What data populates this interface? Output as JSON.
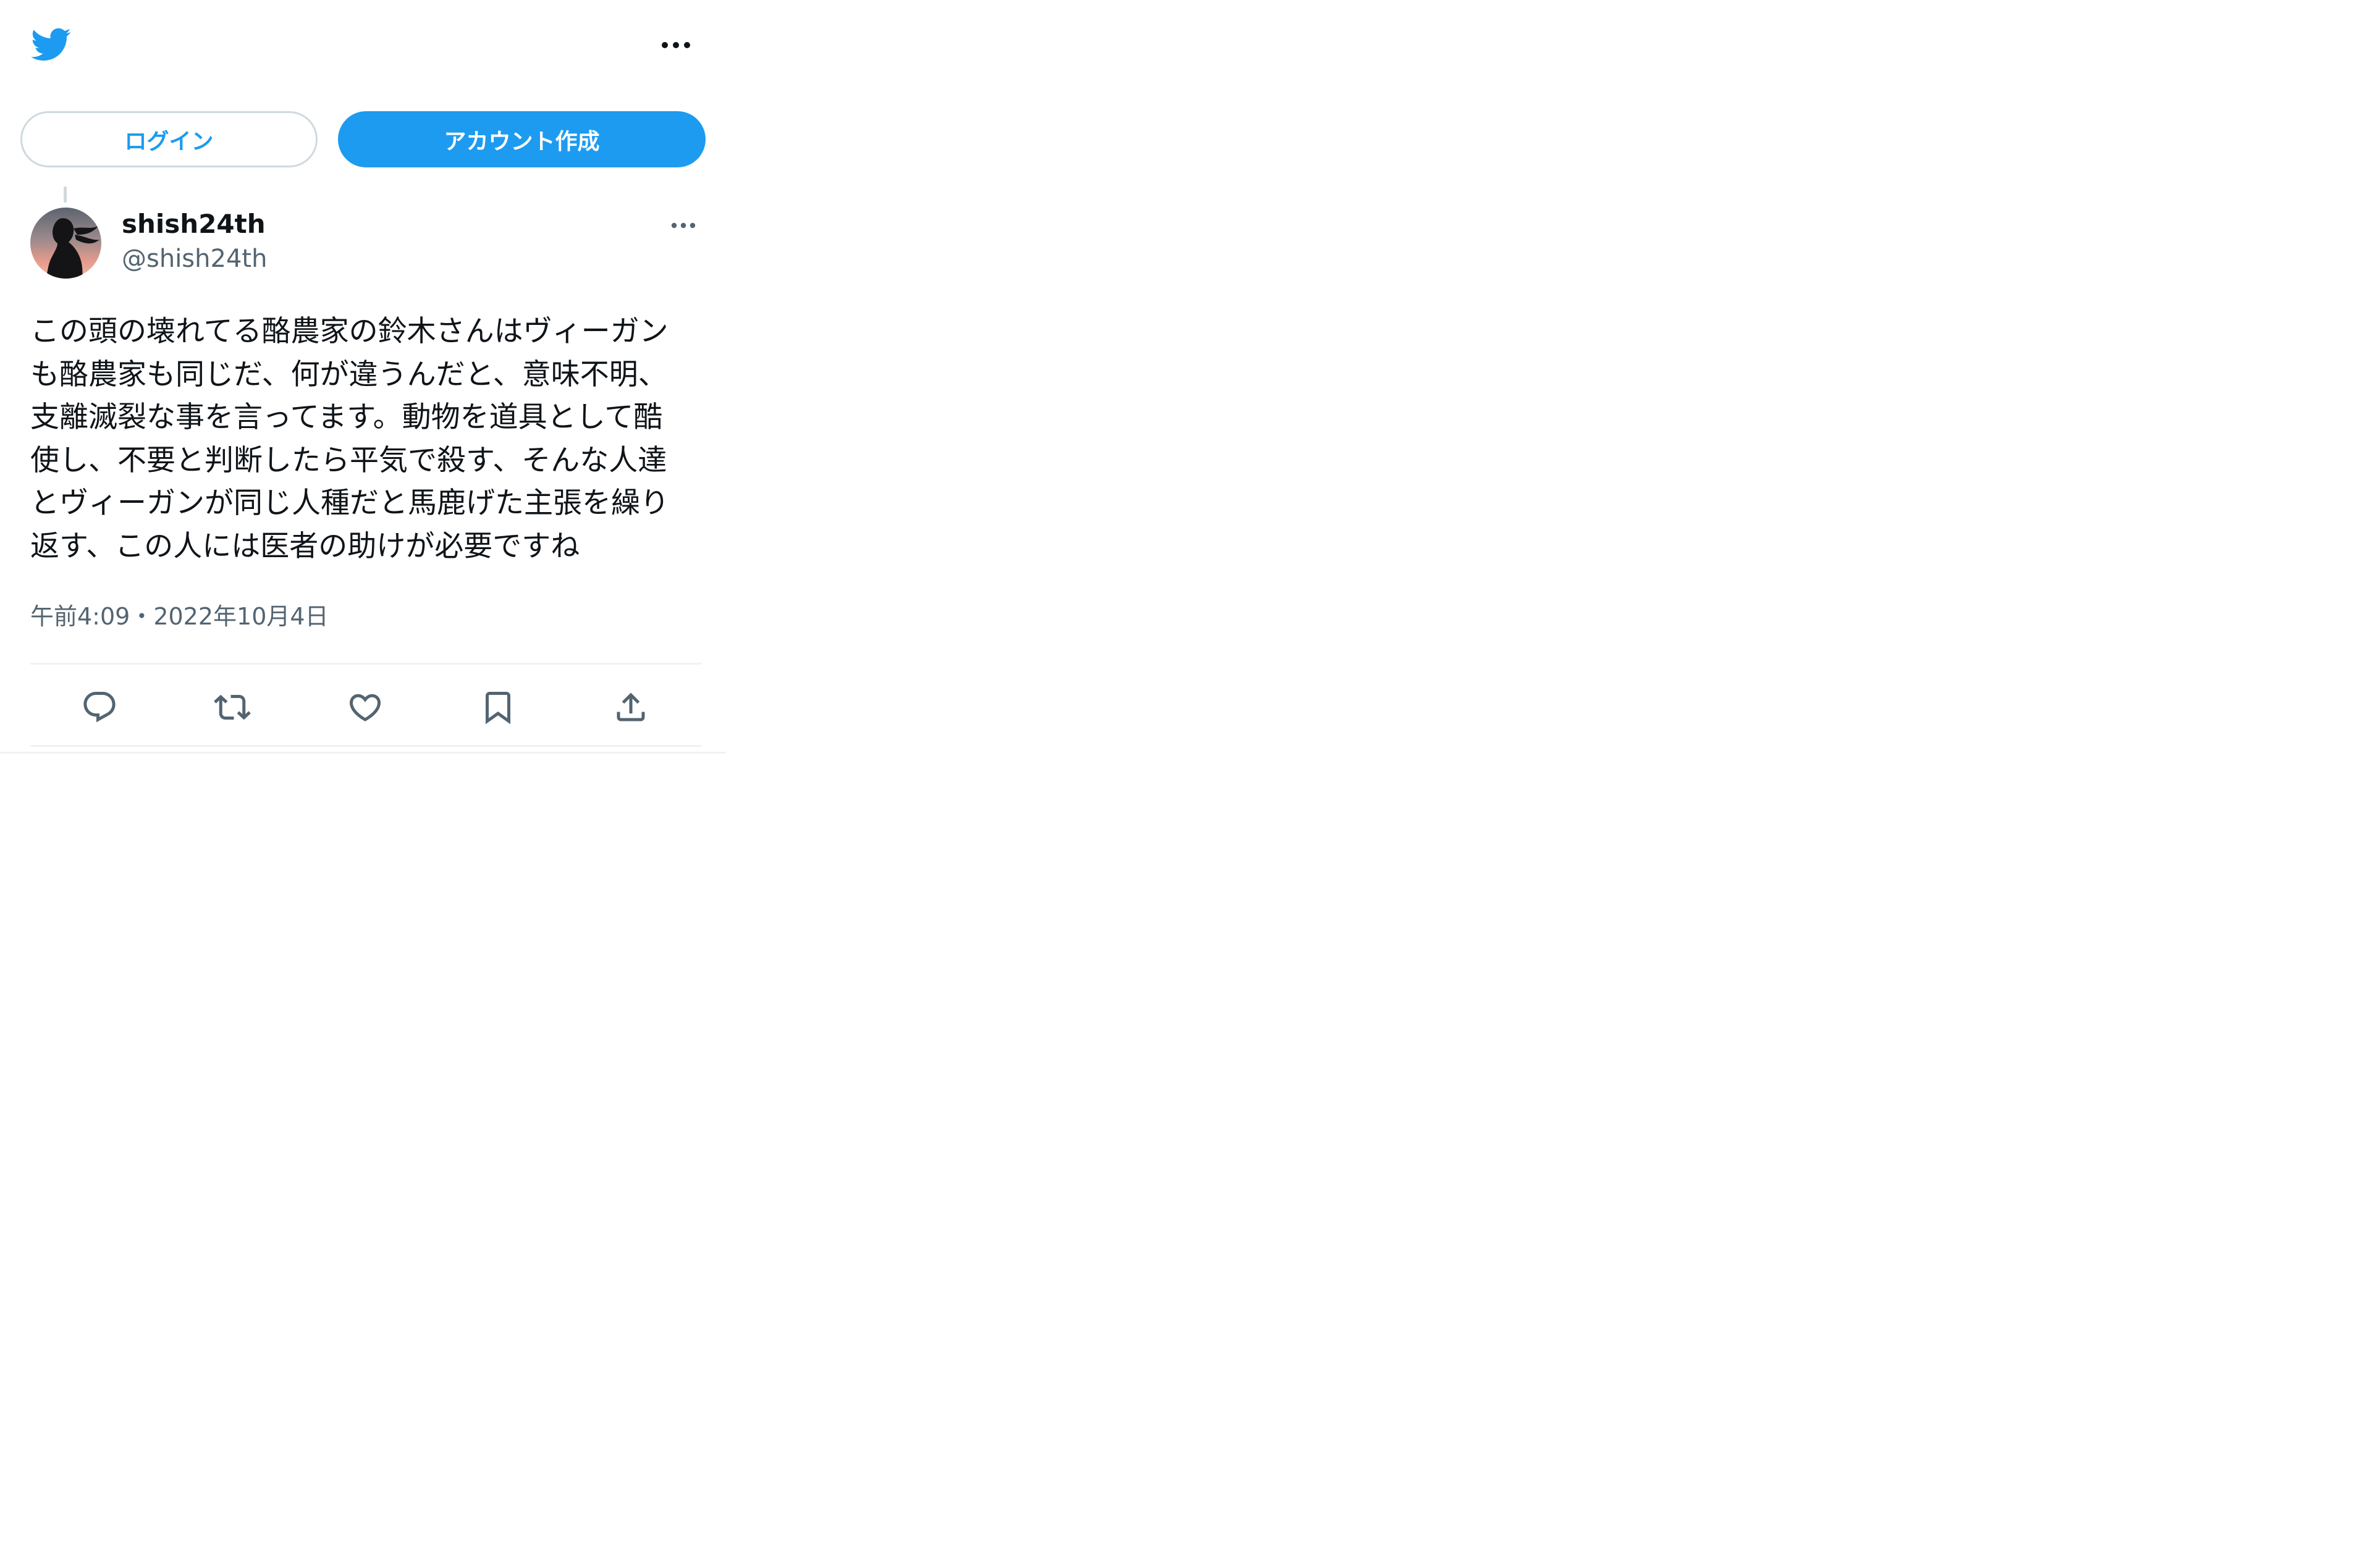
{
  "header": {
    "logo_icon": "twitter-bird-icon",
    "more_icon": "more-horizontal-icon",
    "brand_color": "#1d9bf0"
  },
  "auth": {
    "login_label": "ログイン",
    "signup_label": "アカウント作成"
  },
  "tweet": {
    "author_name": "shish24th",
    "author_handle": "@shish24th",
    "more_icon": "more-horizontal-icon",
    "text": "この頭の壊れてる酪農家の鈴木さんはヴィーガン\nも酪農家も同じだ、何が違うんだと、意味不明、\n支離滅裂な事を言ってます。動物を道具として酷\n使し、不要と判断したら平気で殺す、そんな人達\nとヴィーガンが同じ人種だと馬鹿げた主張を繰り\n返す、この人には医者の助けが必要ですね",
    "timestamp": "午前4:09・2022年10月4日"
  },
  "actions": [
    {
      "icon": "reply-icon"
    },
    {
      "icon": "retweet-icon"
    },
    {
      "icon": "like-icon"
    },
    {
      "icon": "bookmark-icon"
    },
    {
      "icon": "share-icon"
    }
  ]
}
